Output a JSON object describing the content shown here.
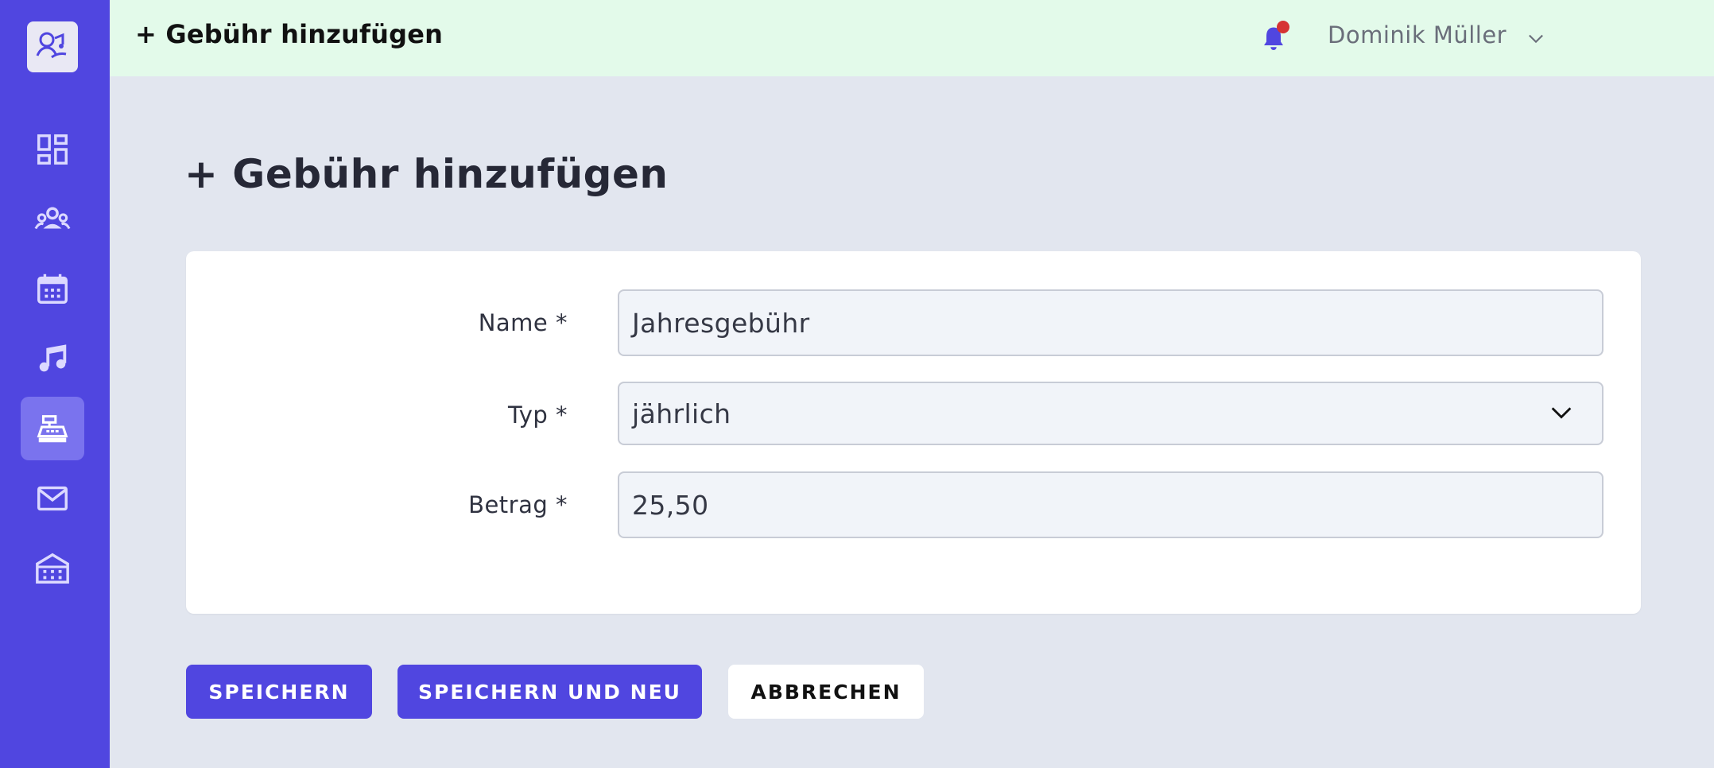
{
  "header": {
    "title": "+ Gebühr hinzufügen",
    "user_name": "Dominik Müller"
  },
  "sidebar": {
    "items": [
      {
        "icon": "dashboard-icon",
        "active": false
      },
      {
        "icon": "members-icon",
        "active": false
      },
      {
        "icon": "calendar-icon",
        "active": false
      },
      {
        "icon": "music-note-icon",
        "active": false
      },
      {
        "icon": "cash-register-icon",
        "active": true
      },
      {
        "icon": "mail-icon",
        "active": false
      },
      {
        "icon": "warehouse-icon",
        "active": false
      }
    ]
  },
  "main": {
    "page_title": "+ Gebühr hinzufügen",
    "form": {
      "name_label": "Name *",
      "name_value": "Jahresgebühr",
      "type_label": "Typ *",
      "type_value": "jährlich",
      "amount_label": "Betrag *",
      "amount_value": "25,50"
    },
    "buttons": {
      "save": "SPEICHERN",
      "save_new": "SPEICHERN UND NEU",
      "cancel": "ABBRECHEN"
    }
  },
  "colors": {
    "accent": "#5046e0",
    "header_bg": "#e3faea",
    "page_bg": "#e2e6ef",
    "notification": "#d63333"
  }
}
